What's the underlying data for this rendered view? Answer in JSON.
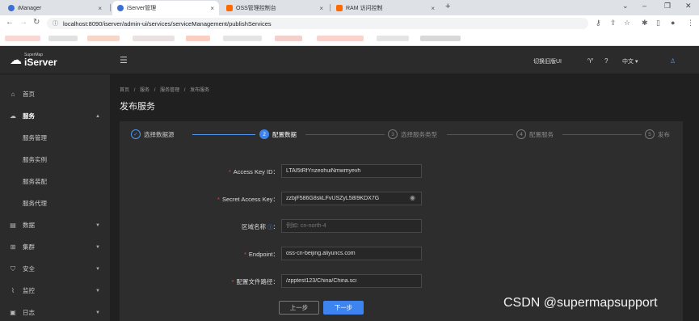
{
  "browser": {
    "tabs": [
      {
        "title": "iManager",
        "favicon_color": "#3b6fd6",
        "active": false
      },
      {
        "title": "iServer管理",
        "favicon_color": "#3b6fd6",
        "active": true
      },
      {
        "title": "OSS管理控制台",
        "favicon_color": "#ff6a00",
        "active": false
      },
      {
        "title": "RAM 访问控制",
        "favicon_color": "#ff6a00",
        "active": false
      }
    ],
    "close_glyph": "×",
    "new_tab_glyph": "+",
    "url": "localhost:8090/iserver/admin-ui/services/serviceManagement/publishServices",
    "window_controls": [
      "⌄",
      "–",
      "❐",
      "✕"
    ]
  },
  "header": {
    "logo_small": "SuperMap",
    "logo_big": "iServer",
    "switch_ui": "切换旧版UI",
    "language": "中文"
  },
  "sidebar": {
    "items": [
      {
        "label": "首页",
        "icon": "home-icon"
      },
      {
        "label": "服务",
        "icon": "cloud-icon",
        "expanded": true
      },
      {
        "label": "数据",
        "icon": "data-icon"
      },
      {
        "label": "集群",
        "icon": "cluster-icon"
      },
      {
        "label": "安全",
        "icon": "shield-icon"
      },
      {
        "label": "监控",
        "icon": "monitor-icon"
      },
      {
        "label": "日志",
        "icon": "log-icon"
      }
    ],
    "subitems": [
      "服务管理",
      "服务实例",
      "服务装配",
      "服务代理"
    ]
  },
  "main": {
    "breadcrumb": [
      "首页",
      "/",
      "服务",
      "/",
      "服务管理",
      "/",
      "发布服务"
    ],
    "title": "发布服务",
    "steps": [
      {
        "num": "✓",
        "label": "选择数据源",
        "state": "done"
      },
      {
        "num": "2",
        "label": "配置数据",
        "state": "active"
      },
      {
        "num": "3",
        "label": "选择服务类型",
        "state": "pending"
      },
      {
        "num": "4",
        "label": "配置服务",
        "state": "pending"
      },
      {
        "num": "5",
        "label": "发布",
        "state": "pending"
      }
    ],
    "form": {
      "access_key_id": {
        "label": "Access Key ID：",
        "value": "LTAI5tRfYnzeohuiNmwmyevh"
      },
      "secret_access_key": {
        "label": "Secret Access Key：",
        "value": "zzbjF586G8skLFvUSZyL58I9KDX7G"
      },
      "region": {
        "label": "区域名称",
        "value": "",
        "placeholder": "例如: cn-north-4"
      },
      "endpoint": {
        "label": "Endpoint：",
        "value": "oss-cn-beijing.aliyuncs.com"
      },
      "config_path": {
        "label": "配置文件路径：",
        "value": "/zpptest123/China/China.sci"
      }
    },
    "buttons": {
      "prev": "上一步",
      "next": "下一步"
    }
  },
  "watermark": "CSDN @supermapsupport"
}
